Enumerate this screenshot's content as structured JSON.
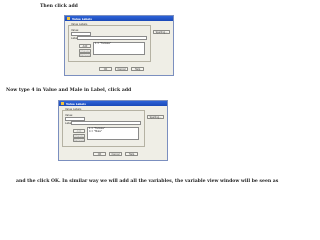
{
  "captions": {
    "first": "Then click add",
    "second": "Now type 4 in Value and Male in Label, click add",
    "third": "and the click OK. In similar way we will add all the variables, the variable view window will be seen as"
  },
  "dialog1": {
    "title": "Value Labels",
    "group_label": "Value Labels",
    "value_label": "Value:",
    "label_label": "Label:",
    "value_field": "",
    "label_field": "",
    "spelling_button": "Spelling...",
    "add_button": "Add",
    "change_button": "Change",
    "remove_button": "Remove",
    "list_items": [
      "1 = \"Female\""
    ],
    "ok_button": "OK",
    "cancel_button": "Cancel",
    "help_button": "Help"
  },
  "dialog2": {
    "title": "Value Labels",
    "group_label": "Value Labels",
    "value_label": "Value:",
    "label_label": "Label:",
    "value_field": "",
    "label_field": "",
    "spelling_button": "Spelling...",
    "add_button": "Add",
    "change_button": "Change",
    "remove_button": "Remove",
    "list_items": [
      "1 = \"Female\"",
      "4 = \"Male\""
    ],
    "ok_button": "OK",
    "cancel_button": "Cancel",
    "help_button": "Help"
  }
}
